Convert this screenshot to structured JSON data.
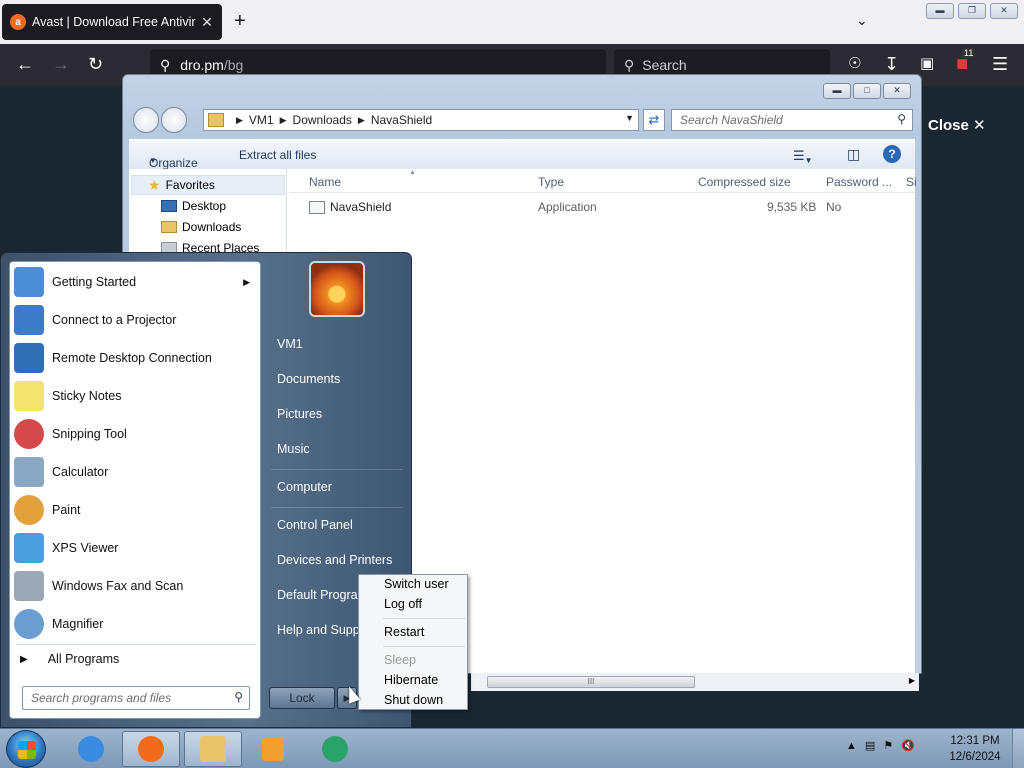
{
  "browser": {
    "tab_title": "Avast | Download Free Antivirus",
    "tab_close": "✕",
    "new_tab": "+",
    "url_domain": "dro.pm",
    "url_path": "/bg",
    "search_placeholder": "Search",
    "page_overlay_close": "Close",
    "extension_badge": "11"
  },
  "explorer": {
    "breadcrumbs": [
      "VM1",
      "Downloads",
      "NavaShield"
    ],
    "search_placeholder": "Search NavaShield",
    "commands": {
      "organize": "Organize",
      "extract_all": "Extract all files"
    },
    "favorites": {
      "header": "Favorites",
      "items": [
        "Desktop",
        "Downloads",
        "Recent Places"
      ]
    },
    "columns": [
      "Name",
      "Type",
      "Compressed size",
      "Password ...",
      "Si"
    ],
    "files": [
      {
        "name": "NavaShield",
        "type": "Application",
        "compressed_size": "9,535 KB",
        "password": "No"
      }
    ],
    "scroll_grip": "III"
  },
  "start_menu": {
    "programs": [
      {
        "label": "Getting Started",
        "has_submenu": true,
        "icon": "getting-started-icon",
        "color": "#4a8fd6"
      },
      {
        "label": "Connect to a Projector",
        "icon": "projector-icon",
        "color": "#3b7bc9"
      },
      {
        "label": "Remote Desktop Connection",
        "icon": "remote-desktop-icon",
        "color": "#2e6fb5"
      },
      {
        "label": "Sticky Notes",
        "icon": "sticky-notes-icon",
        "color": "#f2e46c"
      },
      {
        "label": "Snipping Tool",
        "icon": "snipping-tool-icon",
        "color": "#d44a4a"
      },
      {
        "label": "Calculator",
        "icon": "calculator-icon",
        "color": "#8aa7c4"
      },
      {
        "label": "Paint",
        "icon": "paint-icon",
        "color": "#e2a23b"
      },
      {
        "label": "XPS Viewer",
        "icon": "xps-viewer-icon",
        "color": "#4aa0dc"
      },
      {
        "label": "Windows Fax and Scan",
        "icon": "fax-scan-icon",
        "color": "#9aa8b6"
      },
      {
        "label": "Magnifier",
        "icon": "magnifier-icon",
        "color": "#6c9ed1"
      }
    ],
    "all_programs": "All Programs",
    "search_placeholder": "Search programs and files",
    "right_links": [
      "VM1",
      "Documents",
      "Pictures",
      "Music",
      "Computer",
      "Control Panel",
      "Devices and Printers",
      "Default Programs",
      "Help and Support"
    ],
    "lock_button": "Lock"
  },
  "power_menu": {
    "items": [
      {
        "label": "Switch user",
        "enabled": true
      },
      {
        "label": "Log off",
        "enabled": true
      },
      {
        "label": "Restart",
        "enabled": true
      },
      {
        "label": "Sleep",
        "enabled": false
      },
      {
        "label": "Hibernate",
        "enabled": true
      },
      {
        "label": "Shut down",
        "enabled": true
      }
    ]
  },
  "taskbar": {
    "items": [
      {
        "name": "internet-explorer",
        "color": "#3b8be0"
      },
      {
        "name": "firefox",
        "color": "#f26b1d"
      },
      {
        "name": "windows-explorer",
        "color": "#e8c46a"
      },
      {
        "name": "media-player",
        "color": "#f0a030"
      },
      {
        "name": "avast-setup",
        "color": "#2aa36b"
      }
    ],
    "clock_time": "12:31 PM",
    "clock_date": "12/6/2024"
  }
}
